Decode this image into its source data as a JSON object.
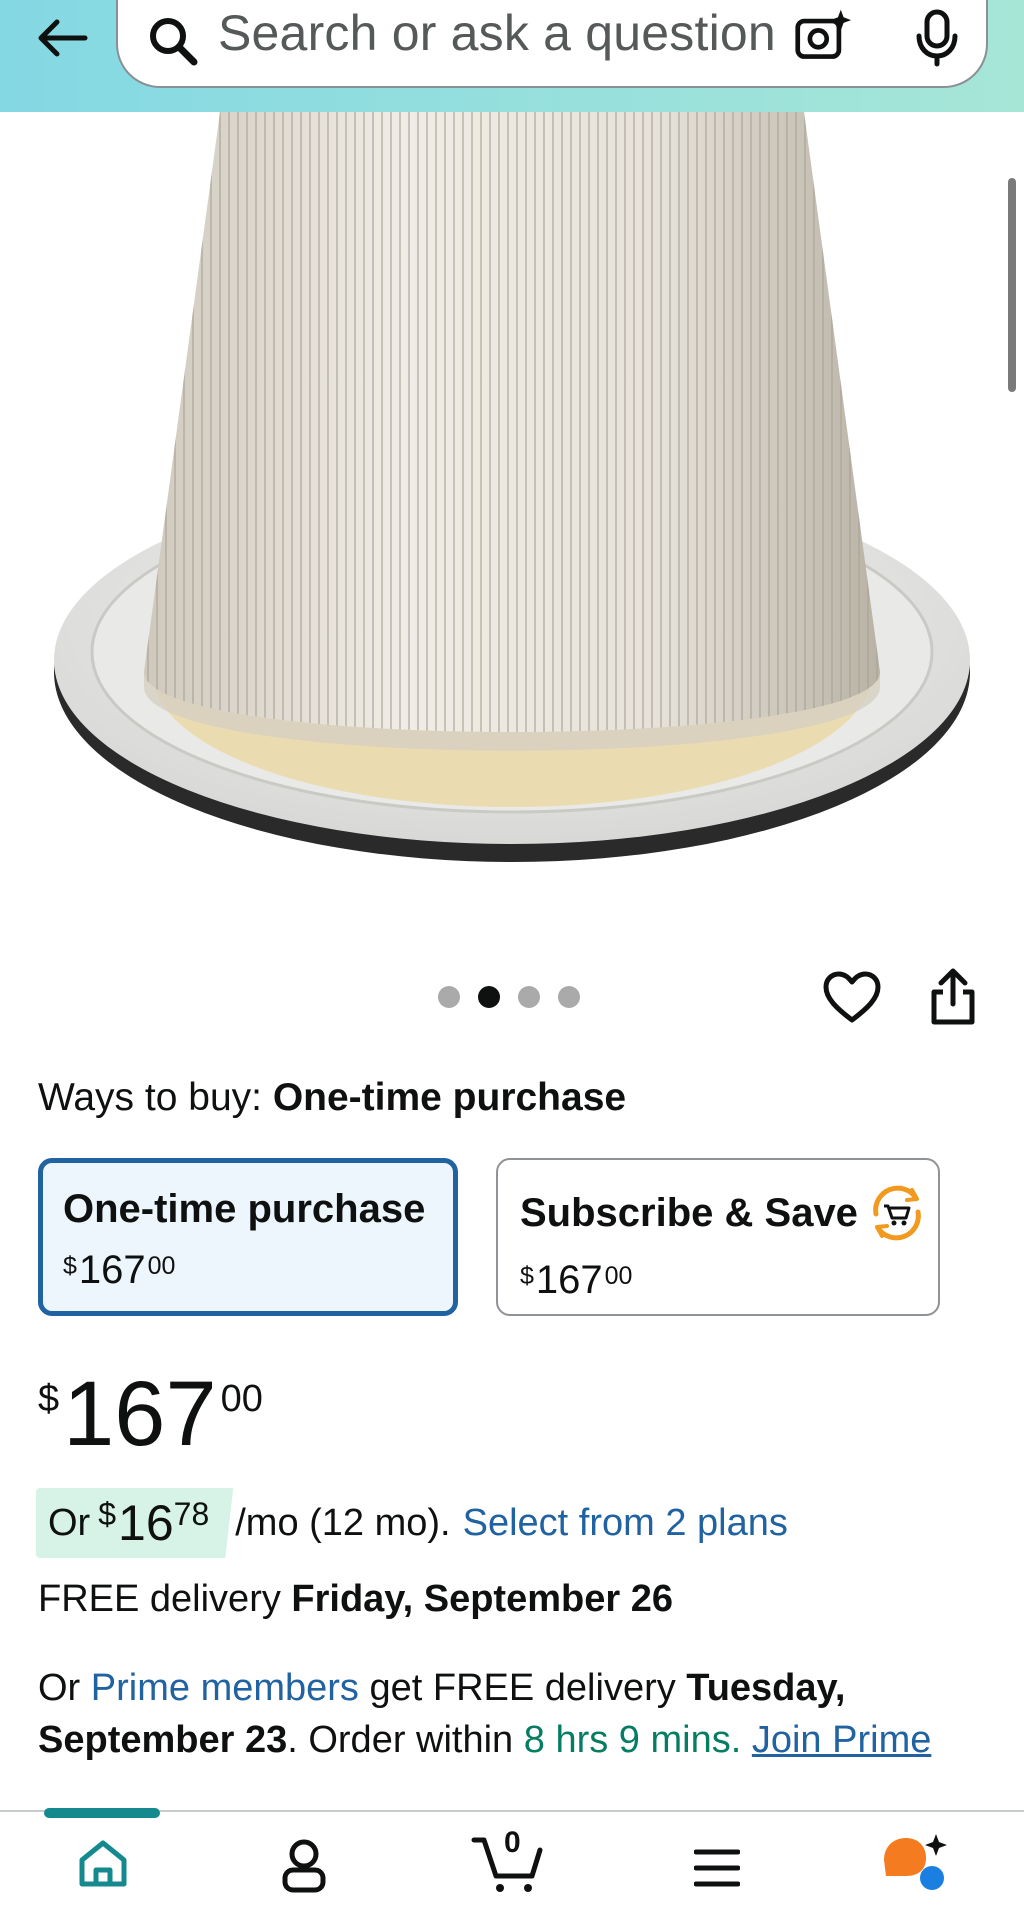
{
  "header": {
    "search_placeholder": "Search or ask a question",
    "icons": [
      "back-arrow-icon",
      "search-icon",
      "camera-icon",
      "mic-icon"
    ]
  },
  "carousel": {
    "total": 4,
    "active_index": 1
  },
  "ways_to_buy": {
    "label": "Ways to buy:",
    "selected": "One-time purchase"
  },
  "options": [
    {
      "title": "One-time purchase",
      "price_symbol": "$",
      "price_whole": "167",
      "price_cents": "00",
      "selected": true
    },
    {
      "title": "Subscribe & Save",
      "price_symbol": "$",
      "price_whole": "167",
      "price_cents": "00",
      "selected": false
    }
  ],
  "price": {
    "symbol": "$",
    "whole": "167",
    "cents": "00"
  },
  "monthly": {
    "prefix": "Or",
    "symbol": "$",
    "whole": "16",
    "cents": "78",
    "suffix": "/mo (12 mo).",
    "link": "Select from 2 plans"
  },
  "delivery": {
    "prefix": "FREE delivery",
    "date": "Friday, September 26"
  },
  "prime": {
    "or": "Or",
    "members_link": "Prime members",
    "get_text": "get FREE delivery",
    "date": "Tuesday, September 23",
    "order_within": ". Order within",
    "countdown": "8 hrs 9 mins.",
    "join_link": "Join Prime"
  },
  "bottom_nav": {
    "cart_count": "0",
    "items": [
      "home-icon",
      "account-icon",
      "cart-icon",
      "menu-icon",
      "rufus-icon"
    ]
  },
  "colors": {
    "header_gradient_start": "#84d8e3",
    "header_gradient_end": "#a6e6d7",
    "link": "#2162a1",
    "selected_border": "#2162a1",
    "selected_bg": "#edf6fd",
    "green_text": "#067d62",
    "monthly_bg": "#d7f3e8",
    "nav_indicator": "#148a8f",
    "rufus_orange": "#f47b20",
    "rufus_blue": "#1a7fe0"
  }
}
